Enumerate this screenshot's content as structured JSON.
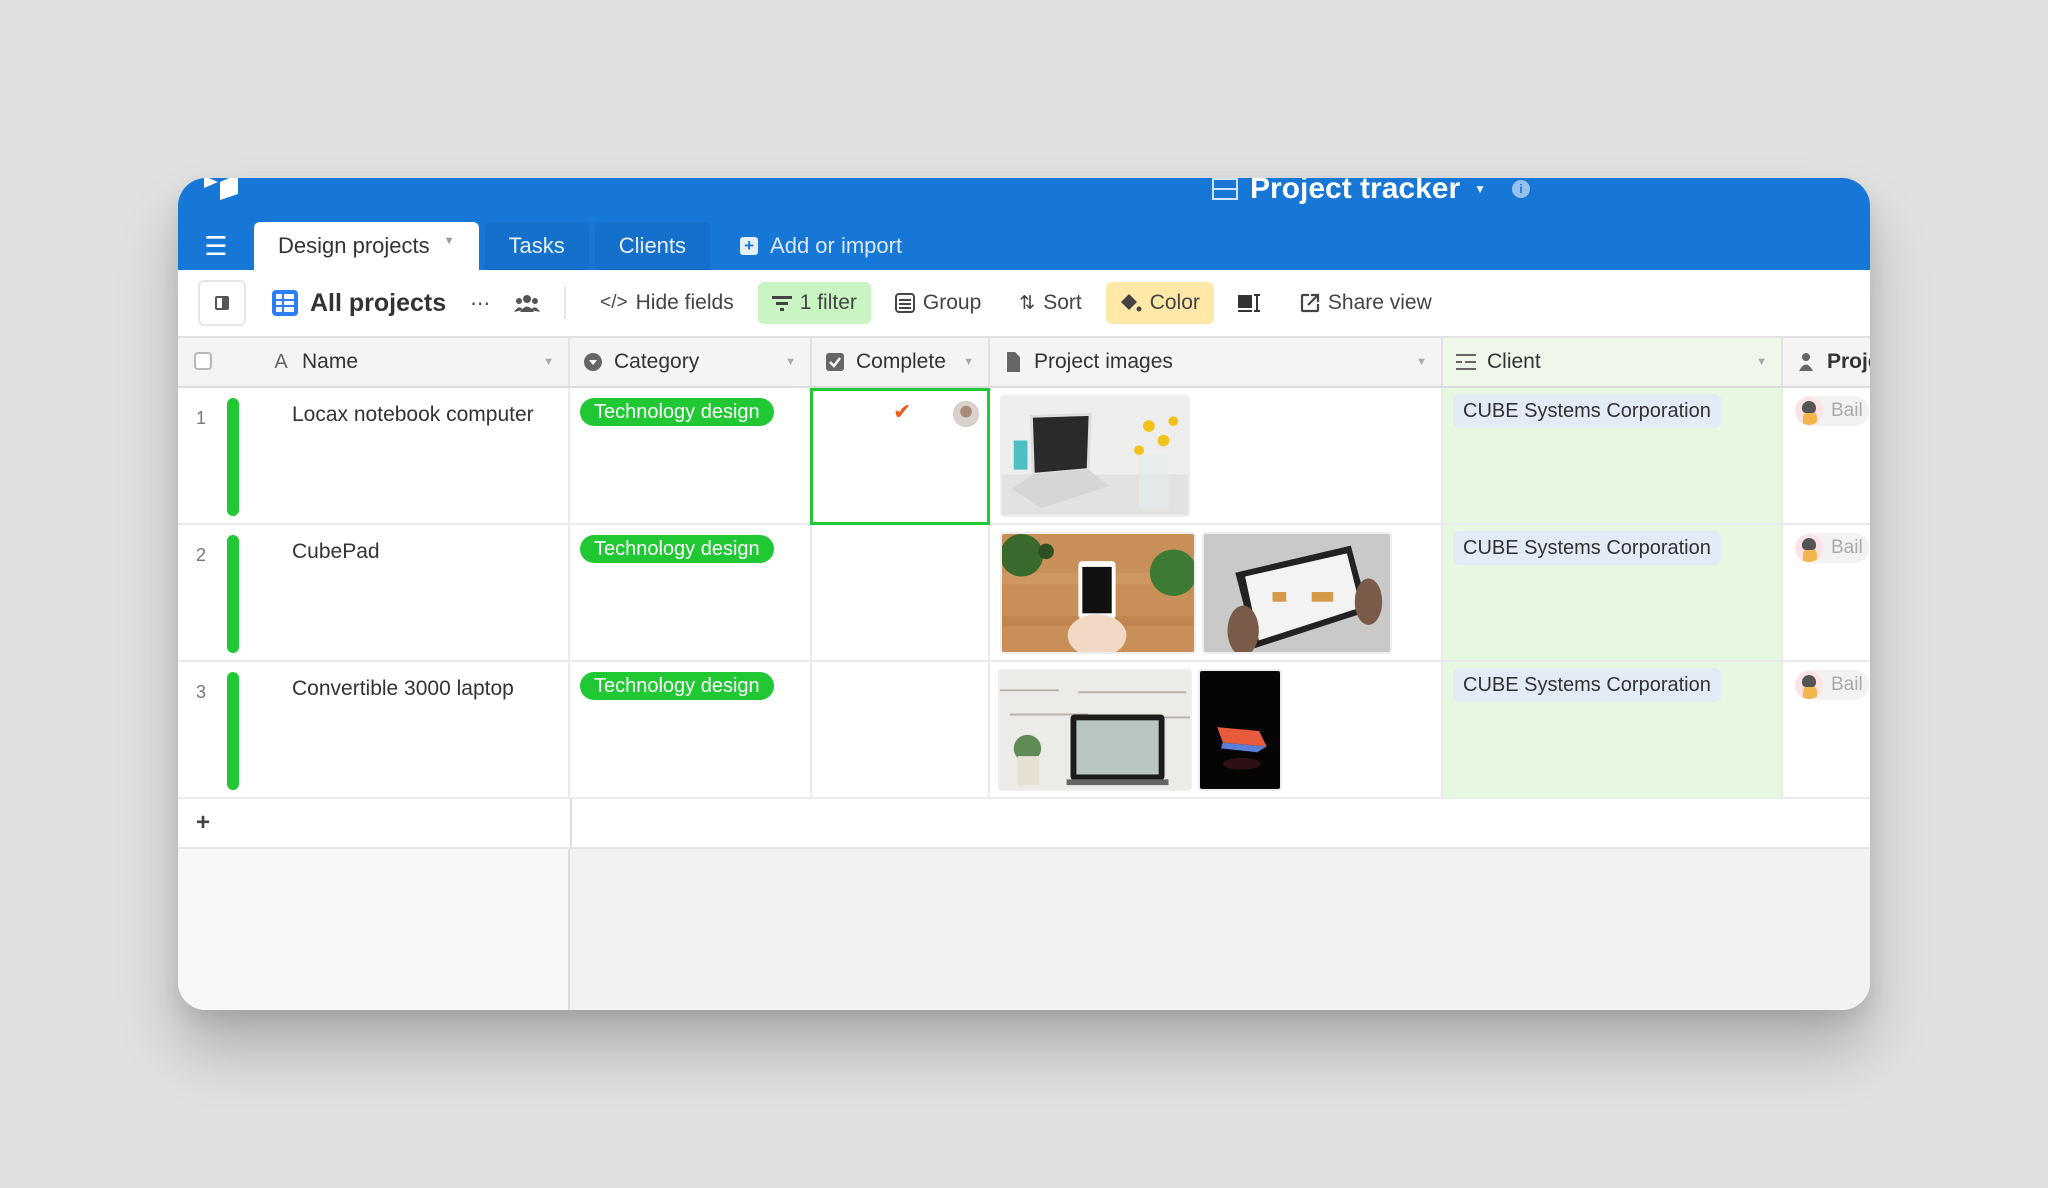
{
  "app": {
    "base_title": "Project tracker",
    "icons": {
      "logo": "airtable-logo-icon",
      "base": "base-icon",
      "caret": "chevron-down-icon",
      "info": "info-icon"
    }
  },
  "tabs": [
    {
      "label": "Design projects",
      "active": true
    },
    {
      "label": "Tasks",
      "active": false
    },
    {
      "label": "Clients",
      "active": false
    }
  ],
  "add_import_label": "Add or import",
  "toolbar": {
    "view_name": "All projects",
    "more_glyph": "⋯",
    "hide_fields": "Hide fields",
    "filter": "1 filter",
    "group": "Group",
    "sort": "Sort",
    "color": "Color",
    "share_view": "Share view",
    "colors": {
      "filter_bg": "#c9f5c2",
      "color_bg": "#ffe8a8"
    }
  },
  "columns": [
    {
      "label": "Name",
      "icon": "text-field-icon"
    },
    {
      "label": "Category",
      "icon": "single-select-icon"
    },
    {
      "label": "Complete",
      "icon": "checkbox-icon"
    },
    {
      "label": "Project images",
      "icon": "attachment-icon"
    },
    {
      "label": "Client",
      "icon": "linked-record-icon"
    },
    {
      "label": "Proje",
      "icon": "user-icon"
    }
  ],
  "rows": [
    {
      "num": "1",
      "name": "Locax notebook computer",
      "category": "Technology design",
      "complete": true,
      "images": [
        "laptop on desk with flowers"
      ],
      "client": "CUBE Systems Corporation",
      "lead": "Bail"
    },
    {
      "num": "2",
      "name": "CubePad",
      "category": "Technology design",
      "complete": false,
      "images": [
        "phone held over wooden table",
        "tablet held in hands"
      ],
      "client": "CUBE Systems Corporation",
      "lead": "Bail"
    },
    {
      "num": "3",
      "name": "Convertible 3000 laptop",
      "category": "Technology design",
      "complete": false,
      "images": [
        "laptop against white brick wall",
        "glowing laptop in dark"
      ],
      "client": "CUBE Systems Corporation",
      "lead": "Bail"
    }
  ],
  "add_row_glyph": "+",
  "colors": {
    "brand_blue": "#1677d6",
    "category_green": "#20c933",
    "check_orange": "#f05b1d",
    "client_chip": "#e3ebf7"
  }
}
